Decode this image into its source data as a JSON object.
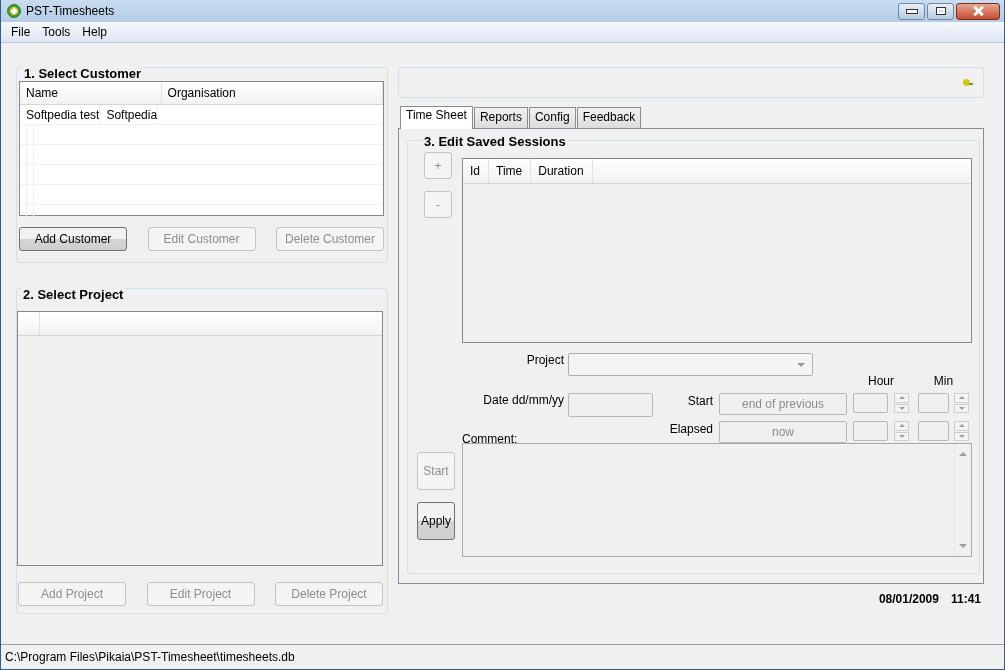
{
  "window": {
    "title": "PST-Timesheets"
  },
  "menu": [
    "File",
    "Tools",
    "Help"
  ],
  "customer_panel": {
    "title": "1. Select Customer",
    "columns": [
      "Name",
      "Organisation"
    ],
    "rows": [
      [
        "Softpedia test",
        "Softpedia"
      ]
    ],
    "buttons": [
      {
        "label": "Add Customer",
        "disabled": false
      },
      {
        "label": "Edit Customer",
        "disabled": true
      },
      {
        "label": "Delete Customer",
        "disabled": true
      }
    ]
  },
  "project_panel": {
    "title": "2. Select Project",
    "buttons": [
      {
        "label": "Add Project",
        "disabled": true
      },
      {
        "label": "Edit Project",
        "disabled": true
      },
      {
        "label": "Delete Project",
        "disabled": true
      }
    ]
  },
  "tabs": [
    {
      "label": "Time Sheet",
      "selected": true
    },
    {
      "label": "Reports",
      "selected": false
    },
    {
      "label": "Config",
      "selected": false
    },
    {
      "label": "Feedback",
      "selected": false
    }
  ],
  "sessions": {
    "title": "3. Edit Saved Sessions",
    "add_button": {
      "label": "+",
      "disabled": true
    },
    "remove_button": {
      "label": "-",
      "disabled": true
    },
    "columns": [
      "Id",
      "Time",
      "Duration"
    ],
    "project_label": "Project",
    "date_label": "Date dd/mm/yy",
    "hour_label": "Hour",
    "min_label": "Min",
    "start_label": "Start",
    "start_value": "end of previous",
    "elapsed_label": "Elapsed",
    "elapsed_value": "now",
    "comment_label": "Comment:",
    "start_button": {
      "label": "Start",
      "disabled": true
    },
    "apply_button": {
      "label": "Apply",
      "disabled": false
    }
  },
  "datetime": {
    "date": "08/01/2009",
    "time": "11:41"
  },
  "status_bar": {
    "path": "C:\\Program Files\\Pikaia\\PST-Timesheet\\timesheets.db"
  }
}
